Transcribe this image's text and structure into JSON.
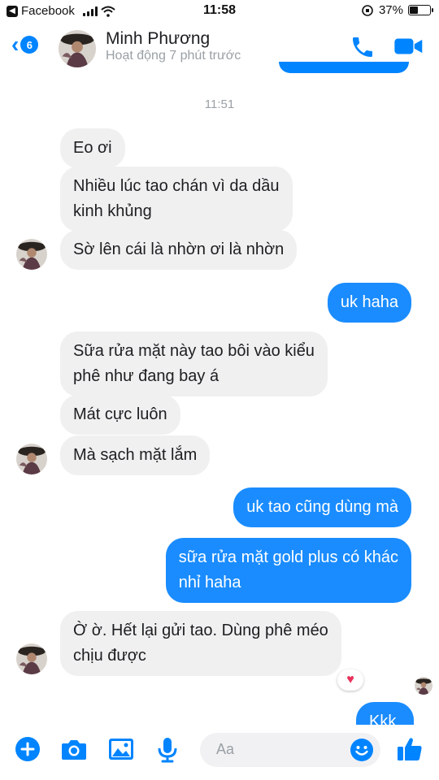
{
  "status_bar": {
    "back_app": "Facebook",
    "time": "11:58",
    "battery": "37%",
    "battery_level": 0.37
  },
  "header": {
    "unread_count": "6",
    "contact_name": "Minh Phương",
    "contact_status": "Hoạt động 7 phút trước"
  },
  "chat": {
    "timestamp": "11:51",
    "messages": [
      {
        "from": "them",
        "text": "Eo ơi"
      },
      {
        "from": "them",
        "text": "Nhiều lúc tao chán vì da dầu\nkinh khủng"
      },
      {
        "from": "them",
        "text": "Sờ lên cái là nhờn ơi là nhờn"
      },
      {
        "from": "me",
        "text": "uk haha"
      },
      {
        "from": "them",
        "text": "Sữa rửa mặt này tao bôi vào kiểu\nphê như đang bay á"
      },
      {
        "from": "them",
        "text": "Mát cực luôn"
      },
      {
        "from": "them",
        "text": "Mà sạch mặt lắm"
      },
      {
        "from": "me",
        "text": "uk tao cũng dùng mà"
      },
      {
        "from": "me",
        "text": "sữa rửa mặt gold plus có khác\nnhỉ haha"
      },
      {
        "from": "them",
        "text": "Ờ ờ. Hết lại gửi tao. Dùng phê méo\nchịu được"
      },
      {
        "from": "me",
        "text": "Kkk"
      }
    ],
    "reaction": "heart"
  },
  "composer": {
    "placeholder": "Aa",
    "icons": [
      "plus-icon",
      "camera-icon",
      "image-icon",
      "microphone-icon",
      "emoji-icon",
      "thumbs-up-icon"
    ]
  },
  "colors": {
    "accent": "#0084ff",
    "incoming_bubble": "#f1f0f0",
    "outgoing_bubble": "#1a8cff"
  }
}
